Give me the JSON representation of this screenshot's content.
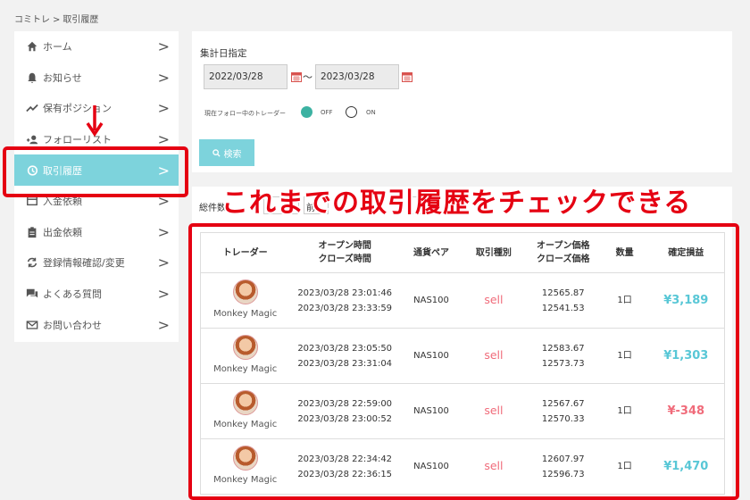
{
  "breadcrumb": [
    "コミトレ",
    ">",
    "取引履歴"
  ],
  "sidebar": {
    "items": [
      {
        "icon": "home-icon",
        "label": "ホーム"
      },
      {
        "icon": "bell-icon",
        "label": "お知らせ"
      },
      {
        "icon": "trend-icon",
        "label": "保有ポジション"
      },
      {
        "icon": "follow-icon",
        "label": "フォローリスト"
      },
      {
        "icon": "history-icon",
        "label": "取引履歴",
        "active": true
      },
      {
        "icon": "deposit-icon",
        "label": "入金依頼"
      },
      {
        "icon": "clipboard-icon",
        "label": "出金依頼"
      },
      {
        "icon": "refresh-icon",
        "label": "登録情報確認/変更"
      },
      {
        "icon": "chat-icon",
        "label": "よくある質問"
      },
      {
        "icon": "mail-icon",
        "label": "お問い合わせ"
      }
    ],
    "chevron": ">"
  },
  "filter": {
    "label": "集計日指定",
    "date_from": "2022/03/28",
    "date_to": "2023/03/28",
    "tilde": "〜",
    "follow_label": "現在フォロー中のトレーダー",
    "off_label": "OFF",
    "on_label": "ON",
    "search_label": "検索"
  },
  "results": {
    "count_label": "総件数",
    "prev_label": "前",
    "overlay": "これまでの取引履歴をチェックできる",
    "columns": [
      "トレーダー",
      "オープン時間\nクローズ時間",
      "通貨ペア",
      "取引種別",
      "オープン価格\nクローズ価格",
      "数量",
      "確定損益"
    ],
    "rows": [
      {
        "trader": "Monkey Magic",
        "open_time": "2023/03/28 23:01:46",
        "close_time": "2023/03/28 23:33:59",
        "pair": "NAS100",
        "type": "sell",
        "open_price": "12565.87",
        "close_price": "12541.53",
        "qty": "1口",
        "pnl": "¥3,189",
        "pnl_sign": "pos"
      },
      {
        "trader": "Monkey Magic",
        "open_time": "2023/03/28 23:05:50",
        "close_time": "2023/03/28 23:31:04",
        "pair": "NAS100",
        "type": "sell",
        "open_price": "12583.67",
        "close_price": "12573.73",
        "qty": "1口",
        "pnl": "¥1,303",
        "pnl_sign": "pos"
      },
      {
        "trader": "Monkey Magic",
        "open_time": "2023/03/28 22:59:00",
        "close_time": "2023/03/28 23:00:52",
        "pair": "NAS100",
        "type": "sell",
        "open_price": "12567.67",
        "close_price": "12570.33",
        "qty": "1口",
        "pnl": "¥-348",
        "pnl_sign": "neg"
      },
      {
        "trader": "Monkey Magic",
        "open_time": "2023/03/28 22:34:42",
        "close_time": "2023/03/28 22:36:15",
        "pair": "NAS100",
        "type": "sell",
        "open_price": "12607.97",
        "close_price": "12596.73",
        "qty": "1口",
        "pnl": "¥1,470",
        "pnl_sign": "pos"
      }
    ]
  },
  "colors": {
    "accent": "#7dd3dc",
    "highlight_red": "#e50012",
    "sell": "#f06b7a",
    "profit_pos": "#58c7d6"
  }
}
